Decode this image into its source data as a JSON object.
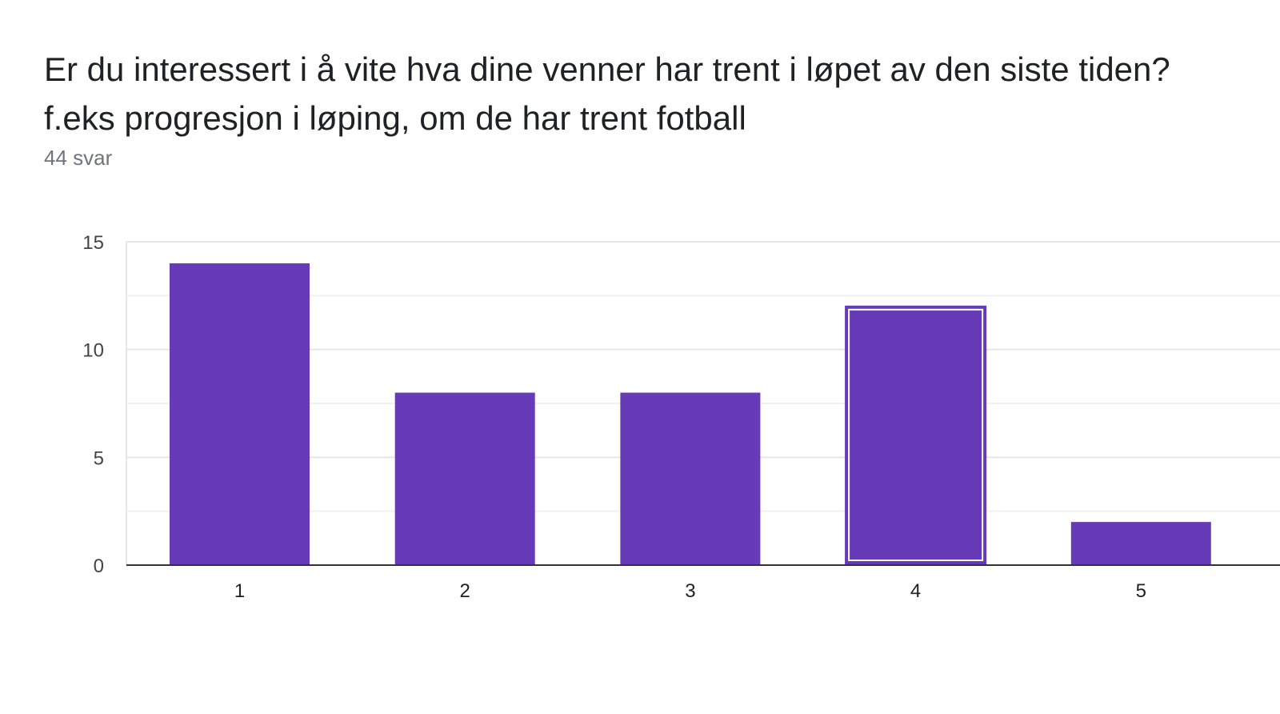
{
  "question": {
    "title": "Er du interessert i å vite hva dine venner har trent i løpet av den siste tiden?f.eks progresjon i løping, om de har trent fotball",
    "response_count": "44 svar"
  },
  "colors": {
    "bar": "#673ab7",
    "bar_highlight_outline": "#673ab7",
    "gridline": "#e6e6e6",
    "baseline": "#333333"
  },
  "chart_data": {
    "type": "bar",
    "categories": [
      "1",
      "2",
      "3",
      "4",
      "5"
    ],
    "values": [
      14,
      8,
      8,
      12,
      2
    ],
    "ylim": [
      0,
      15
    ],
    "yticks": [
      0,
      5,
      10,
      15
    ],
    "grid": true,
    "highlighted_category": "4",
    "title": "",
    "xlabel": "",
    "ylabel": ""
  }
}
